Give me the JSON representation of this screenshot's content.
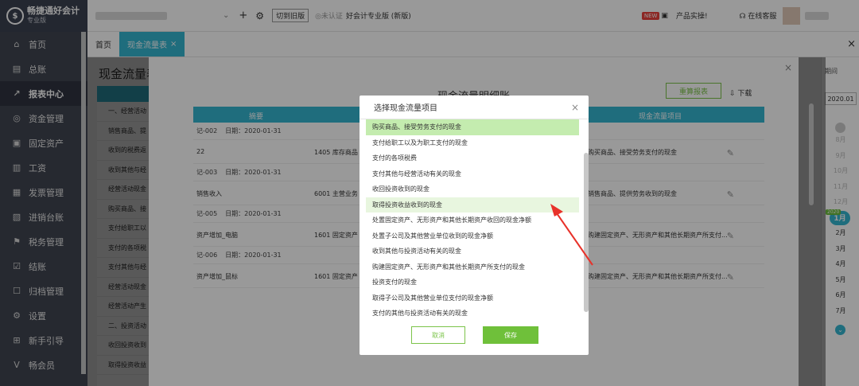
{
  "app": {
    "logo_title": "畅捷通好会计",
    "logo_sub": "专业版",
    "logo_mark": "$"
  },
  "sidebar": {
    "items": [
      {
        "label": "首页",
        "icon": "home-icon",
        "glyph": "⌂"
      },
      {
        "label": "总账",
        "icon": "ledger-icon",
        "glyph": "▤"
      },
      {
        "label": "报表中心",
        "icon": "report-chart-icon",
        "glyph": "↗",
        "active": true
      },
      {
        "label": "资金管理",
        "icon": "fund-icon",
        "glyph": "◎"
      },
      {
        "label": "固定资产",
        "icon": "asset-icon",
        "glyph": "▣"
      },
      {
        "label": "工资",
        "icon": "salary-icon",
        "glyph": "▥"
      },
      {
        "label": "发票管理",
        "icon": "invoice-icon",
        "glyph": "▦"
      },
      {
        "label": "进销台账",
        "icon": "inventory-icon",
        "glyph": "▧"
      },
      {
        "label": "税务管理",
        "icon": "tax-icon",
        "glyph": "⚑"
      },
      {
        "label": "结账",
        "icon": "checkout-icon",
        "glyph": "☑"
      },
      {
        "label": "归档管理",
        "icon": "archive-icon",
        "glyph": "☐"
      },
      {
        "label": "设置",
        "icon": "settings-icon",
        "glyph": "⚙"
      },
      {
        "label": "新手引导",
        "icon": "guide-icon",
        "glyph": "⊞"
      },
      {
        "label": "畅会员",
        "icon": "member-icon",
        "glyph": "V"
      }
    ]
  },
  "topbar": {
    "switch_label": "切到旧版",
    "cert_label": "◎未认证",
    "edition": "好会计专业版 (新版)",
    "new_badge": "NEW",
    "product_label": "产品实操!",
    "service_label": "在线客服"
  },
  "tabs": [
    {
      "label": "首页",
      "active": false
    },
    {
      "label": "现金流量表",
      "active": true,
      "close": "×"
    }
  ],
  "page": {
    "title": "现金流量表",
    "left_rows": [
      "一、经营活动",
      "销售商品、提",
      "收到的税费返",
      "收到其他与经",
      "经营活动现金",
      "购买商品、接",
      "支付给职工以",
      "支付的各项税",
      "支付其他与经",
      "经营活动现金",
      "经营活动产生",
      "二、投资活动",
      "收回投资收到",
      "取得投资收益"
    ]
  },
  "calendar": {
    "label": "期间",
    "year": "2020.01",
    "months": [
      {
        "label": "8月",
        "on": false
      },
      {
        "label": "9月",
        "on": false
      },
      {
        "label": "10月",
        "on": false
      },
      {
        "label": "11月",
        "on": false
      },
      {
        "label": "12月",
        "on": false
      },
      {
        "label": "1月",
        "on": true,
        "current": true
      },
      {
        "label": "2月",
        "on": true
      },
      {
        "label": "3月",
        "on": true
      },
      {
        "label": "4月",
        "on": true
      },
      {
        "label": "5月",
        "on": true
      },
      {
        "label": "6月",
        "on": true
      },
      {
        "label": "7月",
        "on": true
      }
    ],
    "year_mini": "2020"
  },
  "detail_panel": {
    "title": "现金流量明细账",
    "recalc_button": "重算报表",
    "download_label": "下载",
    "columns": [
      "摘要",
      "科目",
      "现金流量项目"
    ],
    "groups": [
      {
        "voucher": "记-002",
        "date": "日期：2020-01-31",
        "summary": "22",
        "account": "1405 库存商品",
        "flow_item": "购买商品、接受劳务支付的现金"
      },
      {
        "voucher": "记-003",
        "date": "日期：2020-01-31",
        "summary": "销售收入",
        "account": "6001 主营业务",
        "flow_item": "销售商品、提供劳务收到的现金"
      },
      {
        "voucher": "记-005",
        "date": "日期：2020-01-31",
        "summary": "资产增加_电脑",
        "account": "1601 固定资产",
        "flow_item": "购建固定资产、无形资产和其他长期资产所支付..."
      },
      {
        "voucher": "记-006",
        "date": "日期：2020-01-31",
        "summary": "资产增加_鼠标",
        "account": "1601 固定资产",
        "flow_item": "购建固定资产、无形资产和其他长期资产所支付..."
      }
    ]
  },
  "dialog": {
    "title": "选择现金流量项目",
    "close": "×",
    "options": [
      {
        "label": "购买商品、接受劳务支付的现金",
        "state": "selected"
      },
      {
        "label": "支付给职工以及为职工支付的现金",
        "state": ""
      },
      {
        "label": "支付的各项税费",
        "state": ""
      },
      {
        "label": "支付其他与经营活动有关的现金",
        "state": ""
      },
      {
        "label": "收回投资收到的现金",
        "state": ""
      },
      {
        "label": "取得投资收益收到的现金",
        "state": "hover"
      },
      {
        "label": "处置固定资产、无形资产和其他长期资产收回的现金净额",
        "state": ""
      },
      {
        "label": "处置子公司及其他营业单位收到的现金净额",
        "state": ""
      },
      {
        "label": "收到其他与投资活动有关的现金",
        "state": ""
      },
      {
        "label": "购建固定资产、无形资产和其他长期资产所支付的现金",
        "state": ""
      },
      {
        "label": "投资支付的现金",
        "state": ""
      },
      {
        "label": "取得子公司及其他营业单位支付的现金净额",
        "state": ""
      },
      {
        "label": "支付的其他与投资活动有关的现金",
        "state": ""
      }
    ],
    "cancel_label": "取消",
    "save_label": "保存"
  },
  "colors": {
    "accent": "#34b6d1",
    "green": "#6fc03a",
    "selected_bg": "#c4ecaf",
    "arrow": "#e8322a"
  }
}
